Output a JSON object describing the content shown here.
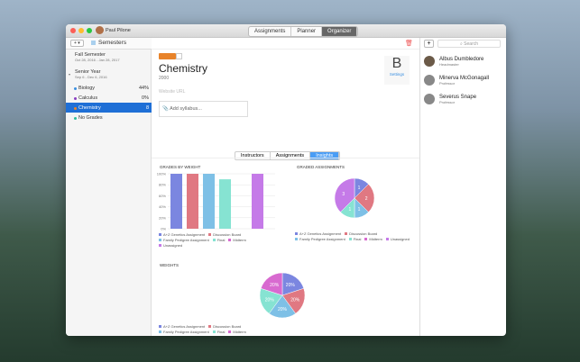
{
  "window": {
    "user": "Paul Pilone",
    "tabs": [
      "Assignments",
      "Planner",
      "Organizer"
    ],
    "active_tab": "Organizer"
  },
  "sidebar": {
    "add_label": "+ ▾",
    "header": "Semesters",
    "fall": {
      "name": "Fall Semester",
      "dates": "Oct 28, 2016 - Jan 28, 2017"
    },
    "senior": {
      "name": "Senior Year",
      "dates": "Sep 6 - Dec 6, 2016"
    },
    "courses": [
      {
        "name": "Biology",
        "grade": "44%",
        "color": "#3a8fe0"
      },
      {
        "name": "Calculus",
        "grade": "0%",
        "color": "#8a3fc0"
      },
      {
        "name": "Chemistry",
        "grade": "8",
        "color": "#e8832a"
      },
      {
        "name": "No Grades",
        "grade": "",
        "color": "#2fbf9a"
      }
    ],
    "selected": "Chemistry"
  },
  "course": {
    "title": "Chemistry",
    "number": "2000",
    "color": "#e8832a",
    "website_placeholder": "Website URL",
    "syllabus": "Add syllabus...",
    "badge_letter": "B",
    "settings": "Settings"
  },
  "subtabs": [
    "Instructors",
    "Assignments",
    "Insights"
  ],
  "active_subtab": "Insights",
  "chart_data": [
    {
      "type": "bar",
      "title": "GRADES BY WEIGHT",
      "categories": [
        "A+Z Genetics Assignment",
        "Discussion Board",
        "Family Pedigree Assignment",
        "Final",
        "Midterm",
        "Unassigned"
      ],
      "values": [
        100,
        100,
        100,
        90,
        0,
        100
      ],
      "yticks": [
        "100%",
        "80%",
        "60%",
        "40%",
        "20%",
        "0%"
      ],
      "ylim": [
        0,
        100
      ],
      "colors": [
        "#7b86e0",
        "#e07882",
        "#7ec0e6",
        "#86e3d2",
        "#d86ad0",
        "#c57ae8"
      ]
    },
    {
      "type": "pie",
      "title": "GRADED ASSIGNMENTS",
      "categories": [
        "A+Z Genetics Assignment",
        "Discussion Board",
        "Family Pedigree Assignment",
        "Final",
        "Midterm",
        "Unassigned"
      ],
      "values": [
        1,
        2,
        1,
        1,
        0,
        3
      ],
      "labels": [
        "1",
        "2",
        "1",
        "1",
        "",
        "3"
      ],
      "colors": [
        "#7b86e0",
        "#e07882",
        "#7ec0e6",
        "#86e3d2",
        "#d86ad0",
        "#c57ae8"
      ]
    },
    {
      "type": "pie",
      "title": "WEIGHTS",
      "categories": [
        "A+Z Genetics Assignment",
        "Discussion Board",
        "Family Pedigree Assignment",
        "Final",
        "Midterm"
      ],
      "values": [
        20,
        20,
        20,
        20,
        20
      ],
      "labels": [
        "20%",
        "20%",
        "20%",
        "20%",
        "20%"
      ],
      "colors": [
        "#7b86e0",
        "#e07882",
        "#7ec0e6",
        "#86e3d2",
        "#d86ad0"
      ]
    }
  ],
  "instructors": {
    "search_placeholder": "Search",
    "add": "+",
    "people": [
      {
        "name": "Albus Dumbledore",
        "role": "Headmaster"
      },
      {
        "name": "Minerva McGonagall",
        "role": "Professor"
      },
      {
        "name": "Severus Snape",
        "role": "Professor"
      }
    ]
  }
}
